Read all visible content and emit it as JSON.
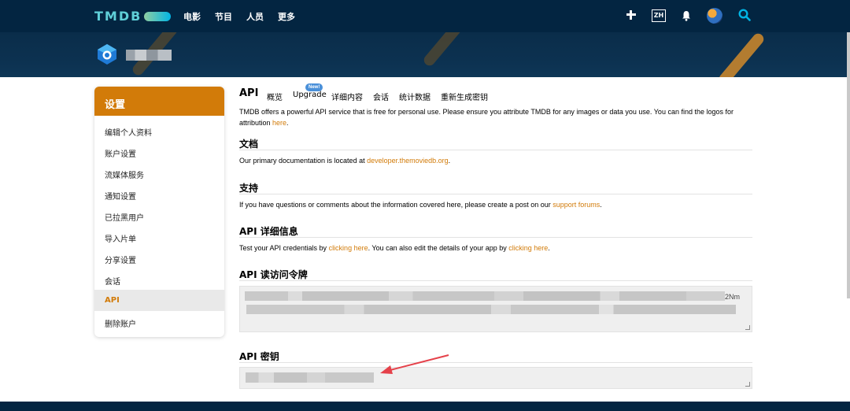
{
  "colors": {
    "nav_bg": "#032541",
    "accent": "#d27b09",
    "logo": "#5fcfd8",
    "active_bg": "#e9e9e9"
  },
  "nav": {
    "logo": "TMDB",
    "links": [
      "电影",
      "节目",
      "人员",
      "更多"
    ],
    "lang": "ZH",
    "icons": [
      "plus-icon",
      "bell-icon",
      "avatar",
      "search-icon"
    ]
  },
  "sidebar": {
    "title": "设置",
    "items": [
      {
        "label": "编辑个人资料"
      },
      {
        "label": "账户设置"
      },
      {
        "label": "流媒体服务"
      },
      {
        "label": "通知设置"
      },
      {
        "label": "已拉黑用户"
      },
      {
        "label": "导入片单"
      },
      {
        "label": "分享设置"
      },
      {
        "label": "会话"
      },
      {
        "label": "API",
        "active": true
      },
      {
        "label": "删除账户"
      }
    ]
  },
  "tabs": {
    "title": "API",
    "items": [
      "概览",
      "Upgrade",
      "详细内容",
      "会话",
      "统计数据",
      "重新生成密钥"
    ],
    "badge": "New!"
  },
  "intro": {
    "text": "TMDB offers a powerful API service that is free for personal use. Please ensure you attribute TMDB for any images or data you use. You can find the logos for attribution ",
    "link": "here",
    "end": "."
  },
  "sections": {
    "docs": {
      "title": "文档",
      "text": "Our primary documentation is located at ",
      "link": "developer.themoviedb.org",
      "end": "."
    },
    "support": {
      "title": "支持",
      "text": "If you have questions or comments about the information covered here, please create a post on our ",
      "link": "support forums",
      "end": "."
    },
    "details": {
      "title": "API 详细信息",
      "text1": "Test your API credentials by ",
      "link1": "clicking here",
      "text2": ". You can also edit the details of your app by ",
      "link2": "clicking here",
      "end": "."
    },
    "token": {
      "title": "API 读访问令牌",
      "visible_tail": "2Nm"
    },
    "key": {
      "title": "API 密钥"
    }
  }
}
